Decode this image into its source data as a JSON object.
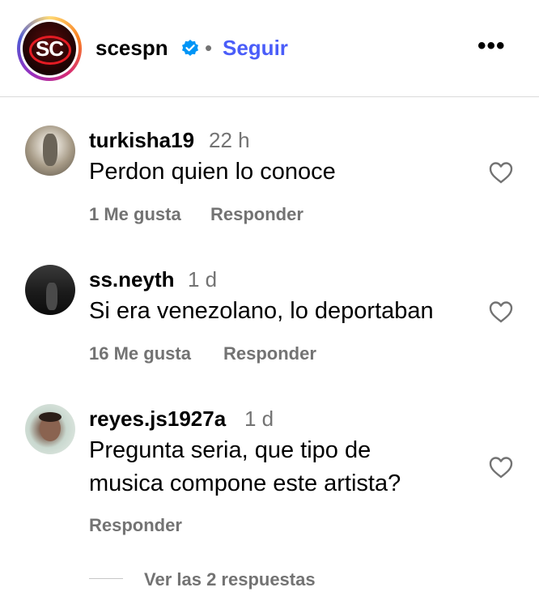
{
  "header": {
    "username": "scespn",
    "logo_text": "SC",
    "separator": "•",
    "follow_label": "Seguir",
    "more_label": "•••",
    "accent_color": "#4a5df9",
    "verified_color": "#0095f6"
  },
  "comments": [
    {
      "username": "turkisha19",
      "time": "22 h",
      "text_lines": [
        "Perdon quien lo conoce"
      ],
      "likes": "1 Me gusta",
      "reply_label": "Responder"
    },
    {
      "username": "ss.neyth",
      "time": "1 d",
      "text_lines": [
        "Si era venezolano, lo deportaban"
      ],
      "likes": "16 Me gusta",
      "reply_label": "Responder"
    },
    {
      "username": "reyes.js1927a",
      "time": "1 d",
      "text_lines": [
        "Pregunta seria, que tipo de",
        "musica compone este artista?"
      ],
      "reply_label": "Responder",
      "view_replies_label": "Ver las 2 respuestas"
    }
  ],
  "icons": [
    "verified-badge-icon",
    "more-options-icon",
    "heart-icon"
  ]
}
